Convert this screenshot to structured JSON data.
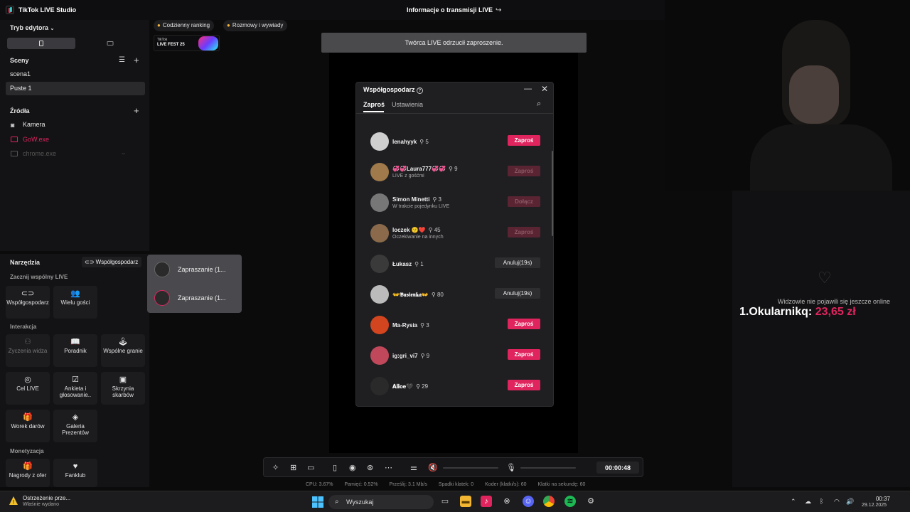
{
  "app": {
    "title": "TikTok LIVE Studio",
    "stream_info": "Informacje o transmisji LIVE"
  },
  "editor": {
    "mode_label": "Tryb edytora"
  },
  "scenes": {
    "title": "Sceny",
    "items": [
      "scena1",
      "Puste 1"
    ]
  },
  "sources": {
    "title": "Źródła",
    "items": [
      "Kamera",
      "GoW.exe",
      "chrome.exe"
    ]
  },
  "top_chips": {
    "ranking": "Codzienny ranking",
    "talks": "Rozmowy i wywiady"
  },
  "livefest": {
    "line1": "TikTok",
    "line2": "LIVE FEST 25"
  },
  "tools": {
    "title": "Narzędzia",
    "cohost_link": "Współgospodarz",
    "section_start": "Zacznij wspólny LIVE",
    "start_items": [
      "Współgospodarz",
      "Wielu gości"
    ],
    "section_interaction": "Interakcja",
    "interaction_items": [
      "Życzenia widza",
      "Poradnik",
      "Wspólne granie",
      "Cel LIVE",
      "Ankieta i głosowanie..",
      "Skrzynia skarbów",
      "Worek darów",
      "Galeria Prezentów"
    ],
    "section_monet": "Monetyzacja",
    "monet_items": [
      "Nagrody z ofer",
      "Fanklub"
    ]
  },
  "invite_popup": {
    "items": [
      "Zapraszanie (1...",
      "Zapraszanie (1..."
    ]
  },
  "toast": "Twórca LIVE odrzucił zaproszenie.",
  "cohost_dialog": {
    "title": "Współgospodarz",
    "tabs": [
      "Zaproś",
      "Ustawienia"
    ],
    "users": [
      {
        "name": "lenahyyk",
        "count": "5",
        "sub": "",
        "button": "Zaproś",
        "state": "active"
      },
      {
        "name": "💞💞Laura777💞💞",
        "count": "9",
        "sub": "LIVE z gośćmi",
        "button": "Zaproś",
        "state": "disabled"
      },
      {
        "name": "Simon Minetti",
        "count": "3",
        "sub": "W trakcie pojedynku LIVE",
        "button": "Dołącz",
        "state": "disabled"
      },
      {
        "name": "loczek 🙂❤️",
        "count": "45",
        "sub": "Oczekiwanie na innych",
        "button": "Zaproś",
        "state": "disabled"
      },
      {
        "name": "Łukasz",
        "count": "1",
        "sub": "",
        "button": "Anuluj(19s)",
        "state": "cancel"
      },
      {
        "name": "👐𝕭𝖆𝖘𝖎𝖊𝖓𝖐𝖆👐",
        "count": "80",
        "sub": "",
        "button": "Anuluj(19s)",
        "state": "cancel"
      },
      {
        "name": "Ma-Rysia",
        "count": "3",
        "sub": "",
        "button": "Zaproś",
        "state": "active"
      },
      {
        "name": "ig:gri_vi7",
        "count": "9",
        "sub": "",
        "button": "Zaproś",
        "state": "active"
      },
      {
        "name": "𝐀𝐥𝐢𝐜𝐞🖤",
        "count": "29",
        "sub": "",
        "button": "Zaproś",
        "state": "active"
      }
    ]
  },
  "overlay": {
    "notice": "Widzowie nie pojawili się jeszcze online",
    "leader_name": "1.Okularnikq:",
    "leader_amount": "23,65 zł"
  },
  "toolbar": {
    "timer": "00:00:48"
  },
  "stats": [
    "CPU: 3.67%",
    "Pamięć: 0.52%",
    "Prześlij: 3.1 Mb/s",
    "Spadki klatek: 0",
    "Koder (klatki/s): 60",
    "Klatki na sekundę: 60"
  ],
  "taskbar": {
    "warning_title": "Ostrzeżenie prze...",
    "warning_sub": "Właśnie wydano",
    "search": "Wyszukaj",
    "time": "00:37",
    "date": "29.12.2025"
  },
  "colors": {
    "accent": "#e0245e",
    "panel": "#131315",
    "dialog": "#1f1f22"
  }
}
